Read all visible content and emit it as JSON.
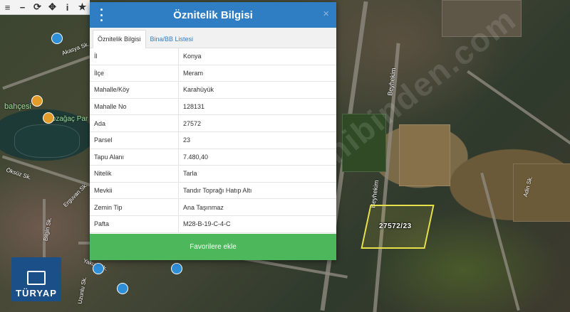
{
  "toolbar": {
    "buttons": [
      {
        "icon": "menu-icon",
        "glyph": "≡"
      },
      {
        "icon": "zoom-out-icon",
        "glyph": "−"
      },
      {
        "icon": "refresh-icon",
        "glyph": "⟳"
      },
      {
        "icon": "crosshair-icon",
        "glyph": "✥"
      },
      {
        "icon": "info-icon",
        "glyph": "i"
      },
      {
        "icon": "star-icon",
        "glyph": "★"
      }
    ]
  },
  "map": {
    "labels": {
      "bahcesi": "bahçesi",
      "kozagac": "Kozağaç Par",
      "akasya": "Akasya Sk.",
      "oksuz": "Öksüz Sk.",
      "erguvan": "Erguvan Sk.",
      "bilgin": "Bilgin Sk.",
      "yakup": "Yakup Sk.",
      "uzun": "Uzunlu Sk.",
      "beyhekim1": "Beyhekim",
      "beyhekim2": "Beyhekim",
      "adin": "Adin Sk."
    },
    "parcel_label": "27572/23",
    "watermark": "sahibinden.com",
    "logo_text": "TÜRYAP"
  },
  "dialog": {
    "title": "Öznitelik Bilgisi",
    "close": "×",
    "tabs": [
      "Öznitelik Bilgisi",
      "Bina/BB Listesi"
    ],
    "rows": [
      {
        "key": "İl",
        "value": "Konya"
      },
      {
        "key": "İlçe",
        "value": "Meram"
      },
      {
        "key": "Mahalle/Köy",
        "value": "Karahüyük"
      },
      {
        "key": "Mahalle No",
        "value": "128131"
      },
      {
        "key": "Ada",
        "value": "27572"
      },
      {
        "key": "Parsel",
        "value": "23"
      },
      {
        "key": "Tapu Alanı",
        "value": "7.480,40"
      },
      {
        "key": "Nitelik",
        "value": "Tarla"
      },
      {
        "key": "Mevkii",
        "value": "Tandır Toprağı Hatıp Altı"
      },
      {
        "key": "Zemin Tip",
        "value": "Ana Taşınmaz"
      },
      {
        "key": "Pafta",
        "value": "M28-B-19-C-4-C"
      }
    ],
    "favorite_button": "Favorilere ekle"
  }
}
